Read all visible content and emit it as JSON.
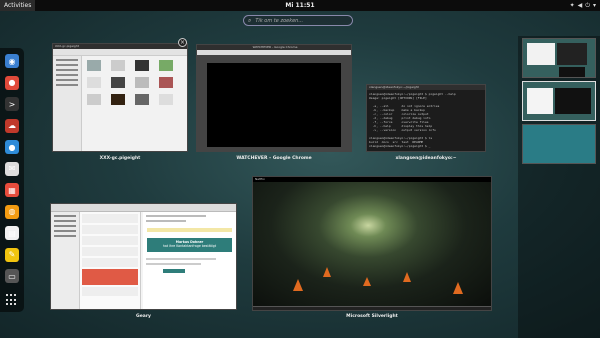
{
  "topbar": {
    "activities": "Activities",
    "clock": "Mi 11:51"
  },
  "search": {
    "placeholder": "Tik om te zoeken..."
  },
  "windows": [
    {
      "label": "XXX-gc.pigeight",
      "title": "XXX-gc.pigeight"
    },
    {
      "label": "WATCHEVER – Google Chrome",
      "title": "WATCHEVER - Google Chrome"
    },
    {
      "label": "xlangsen@ideanfokyo:~",
      "title": "xlangsen@ideanfokyo:~/pigeight"
    },
    {
      "label": "Geary",
      "title": "Geary",
      "heading": "Markus Dohner",
      "subheading": "hat ihre Kontaktanfrage bestätigt"
    },
    {
      "label": "Microsoft Silverlight",
      "title": "Netflix"
    }
  ],
  "terminal_lines": [
    "xlangsen@ideanfokyo:~/pigeight $ pigeight --help",
    "Usage: pigeight [OPTIONS] [FILE]",
    "",
    "  -a, --all       do not ignore entries",
    "  -b, --backup    make a backup",
    "  -c, --color     colorize output",
    "  -d, --debug     print debug info",
    "  -f, --force     overwrite files",
    "  -h, --help      display this help",
    "  -v, --version   output version info",
    "",
    "xlangsen@ideanfokyo:~/pigeight $ ls",
    "build  docs  src  test  README",
    "xlangsen@ideanfokyo:~/pigeight $ _"
  ],
  "dash_apps": [
    {
      "name": "earth-icon",
      "color": "#3a7fd0",
      "glyph": "◉"
    },
    {
      "name": "chrome-icon",
      "color": "#e04a3a",
      "glyph": "●"
    },
    {
      "name": "terminal-icon",
      "color": "#333333",
      "glyph": ">"
    },
    {
      "name": "cloud-icon",
      "color": "#c0392b",
      "glyph": "☁"
    },
    {
      "name": "chat-icon",
      "color": "#2e8bd8",
      "glyph": "●"
    },
    {
      "name": "mail-icon",
      "color": "#dddddd",
      "glyph": "✉"
    },
    {
      "name": "calendar-icon",
      "color": "#e74c3c",
      "glyph": "▦"
    },
    {
      "name": "firefox-icon",
      "color": "#f39c12",
      "glyph": "◍"
    },
    {
      "name": "document-icon",
      "color": "#f2f2f2",
      "glyph": "▤"
    },
    {
      "name": "notes-icon",
      "color": "#f1c40f",
      "glyph": "✎"
    },
    {
      "name": "screen-icon",
      "color": "#555555",
      "glyph": "▭"
    }
  ],
  "colors": {
    "accent": "#2e7d7a",
    "topbar": "#0c0c0c"
  }
}
